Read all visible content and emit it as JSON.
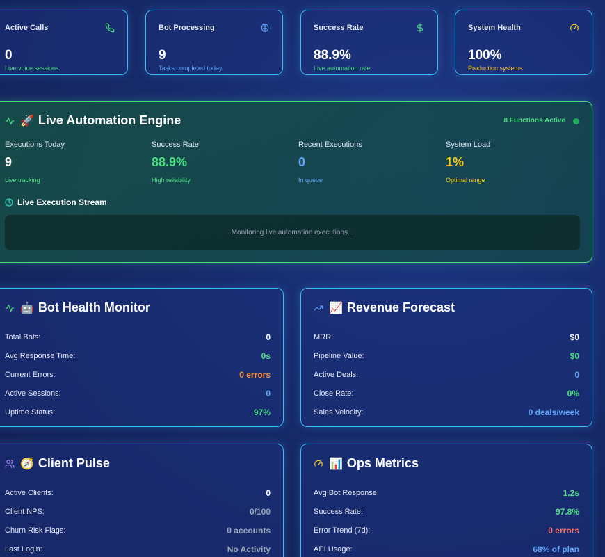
{
  "stats": [
    {
      "label": "Active Calls",
      "value": "0",
      "sub": "Live voice sessions",
      "icon": "phone-icon",
      "color": "#4ade80"
    },
    {
      "label": "Bot Processing",
      "value": "9",
      "sub": "Tasks completed today",
      "icon": "brain-icon",
      "color": "#60a5fa"
    },
    {
      "label": "Success Rate",
      "value": "88.9%",
      "sub": "Live automation rate",
      "icon": "dollar-icon",
      "color": "#4ade80"
    },
    {
      "label": "System Health",
      "value": "100%",
      "sub": "Production systems",
      "icon": "gauge-icon",
      "color": "#facc15"
    }
  ],
  "engine": {
    "title": "Live Automation Engine",
    "emoji": "🚀",
    "active_label": "8 Functions Active",
    "metrics": [
      {
        "label": "Executions Today",
        "value": "9",
        "sub": "Live tracking",
        "value_color": "#ffffff",
        "sub_color": "#4ade80"
      },
      {
        "label": "Success Rate",
        "value": "88.9%",
        "sub": "High reliability",
        "value_color": "#4ade80",
        "sub_color": "#4ade80"
      },
      {
        "label": "Recent Executions",
        "value": "0",
        "sub": "In queue",
        "value_color": "#60a5fa",
        "sub_color": "#60a5fa"
      },
      {
        "label": "System Load",
        "value": "1%",
        "sub": "Optimal range",
        "value_color": "#facc15",
        "sub_color": "#facc15"
      }
    ],
    "stream_title": "Live Execution Stream",
    "stream_placeholder": "Monitoring live automation executions..."
  },
  "bot_health": {
    "title": "Bot Health Monitor",
    "emoji": "🤖",
    "rows": [
      {
        "label": "Total Bots:",
        "value": "0",
        "color": "#ffffff"
      },
      {
        "label": "Avg Response Time:",
        "value": "0s",
        "color": "#4ade80"
      },
      {
        "label": "Current Errors:",
        "value": "0 errors",
        "color": "#fb923c"
      },
      {
        "label": "Active Sessions:",
        "value": "0",
        "color": "#60a5fa"
      },
      {
        "label": "Uptime Status:",
        "value": "97%",
        "color": "#4ade80"
      }
    ]
  },
  "revenue": {
    "title": "Revenue Forecast",
    "emoji": "📈",
    "rows": [
      {
        "label": "MRR:",
        "value": "$0",
        "color": "#ffffff"
      },
      {
        "label": "Pipeline Value:",
        "value": "$0",
        "color": "#4ade80"
      },
      {
        "label": "Active Deals:",
        "value": "0",
        "color": "#60a5fa"
      },
      {
        "label": "Close Rate:",
        "value": "0%",
        "color": "#4ade80"
      },
      {
        "label": "Sales Velocity:",
        "value": "0 deals/week",
        "color": "#60a5fa"
      }
    ]
  },
  "client_pulse": {
    "title": "Client Pulse",
    "emoji": "🧭",
    "rows": [
      {
        "label": "Active Clients:",
        "value": "0",
        "color": "#ffffff"
      },
      {
        "label": "Client NPS:",
        "value": "0/100",
        "color": "#9aa7b8"
      },
      {
        "label": "Churn Risk Flags:",
        "value": "0 accounts",
        "color": "#9aa7b8"
      },
      {
        "label": "Last Login:",
        "value": "No Activity",
        "color": "#9aa7b8"
      }
    ]
  },
  "ops": {
    "title": "Ops Metrics",
    "emoji": "📊",
    "rows": [
      {
        "label": "Avg Bot Response:",
        "value": "1.2s",
        "color": "#4ade80"
      },
      {
        "label": "Success Rate:",
        "value": "97.8%",
        "color": "#4ade80"
      },
      {
        "label": "Error Trend (7d):",
        "value": "0 errors",
        "color": "#f87171"
      },
      {
        "label": "API Usage:",
        "value": "68% of plan",
        "color": "#60a5fa"
      }
    ]
  }
}
